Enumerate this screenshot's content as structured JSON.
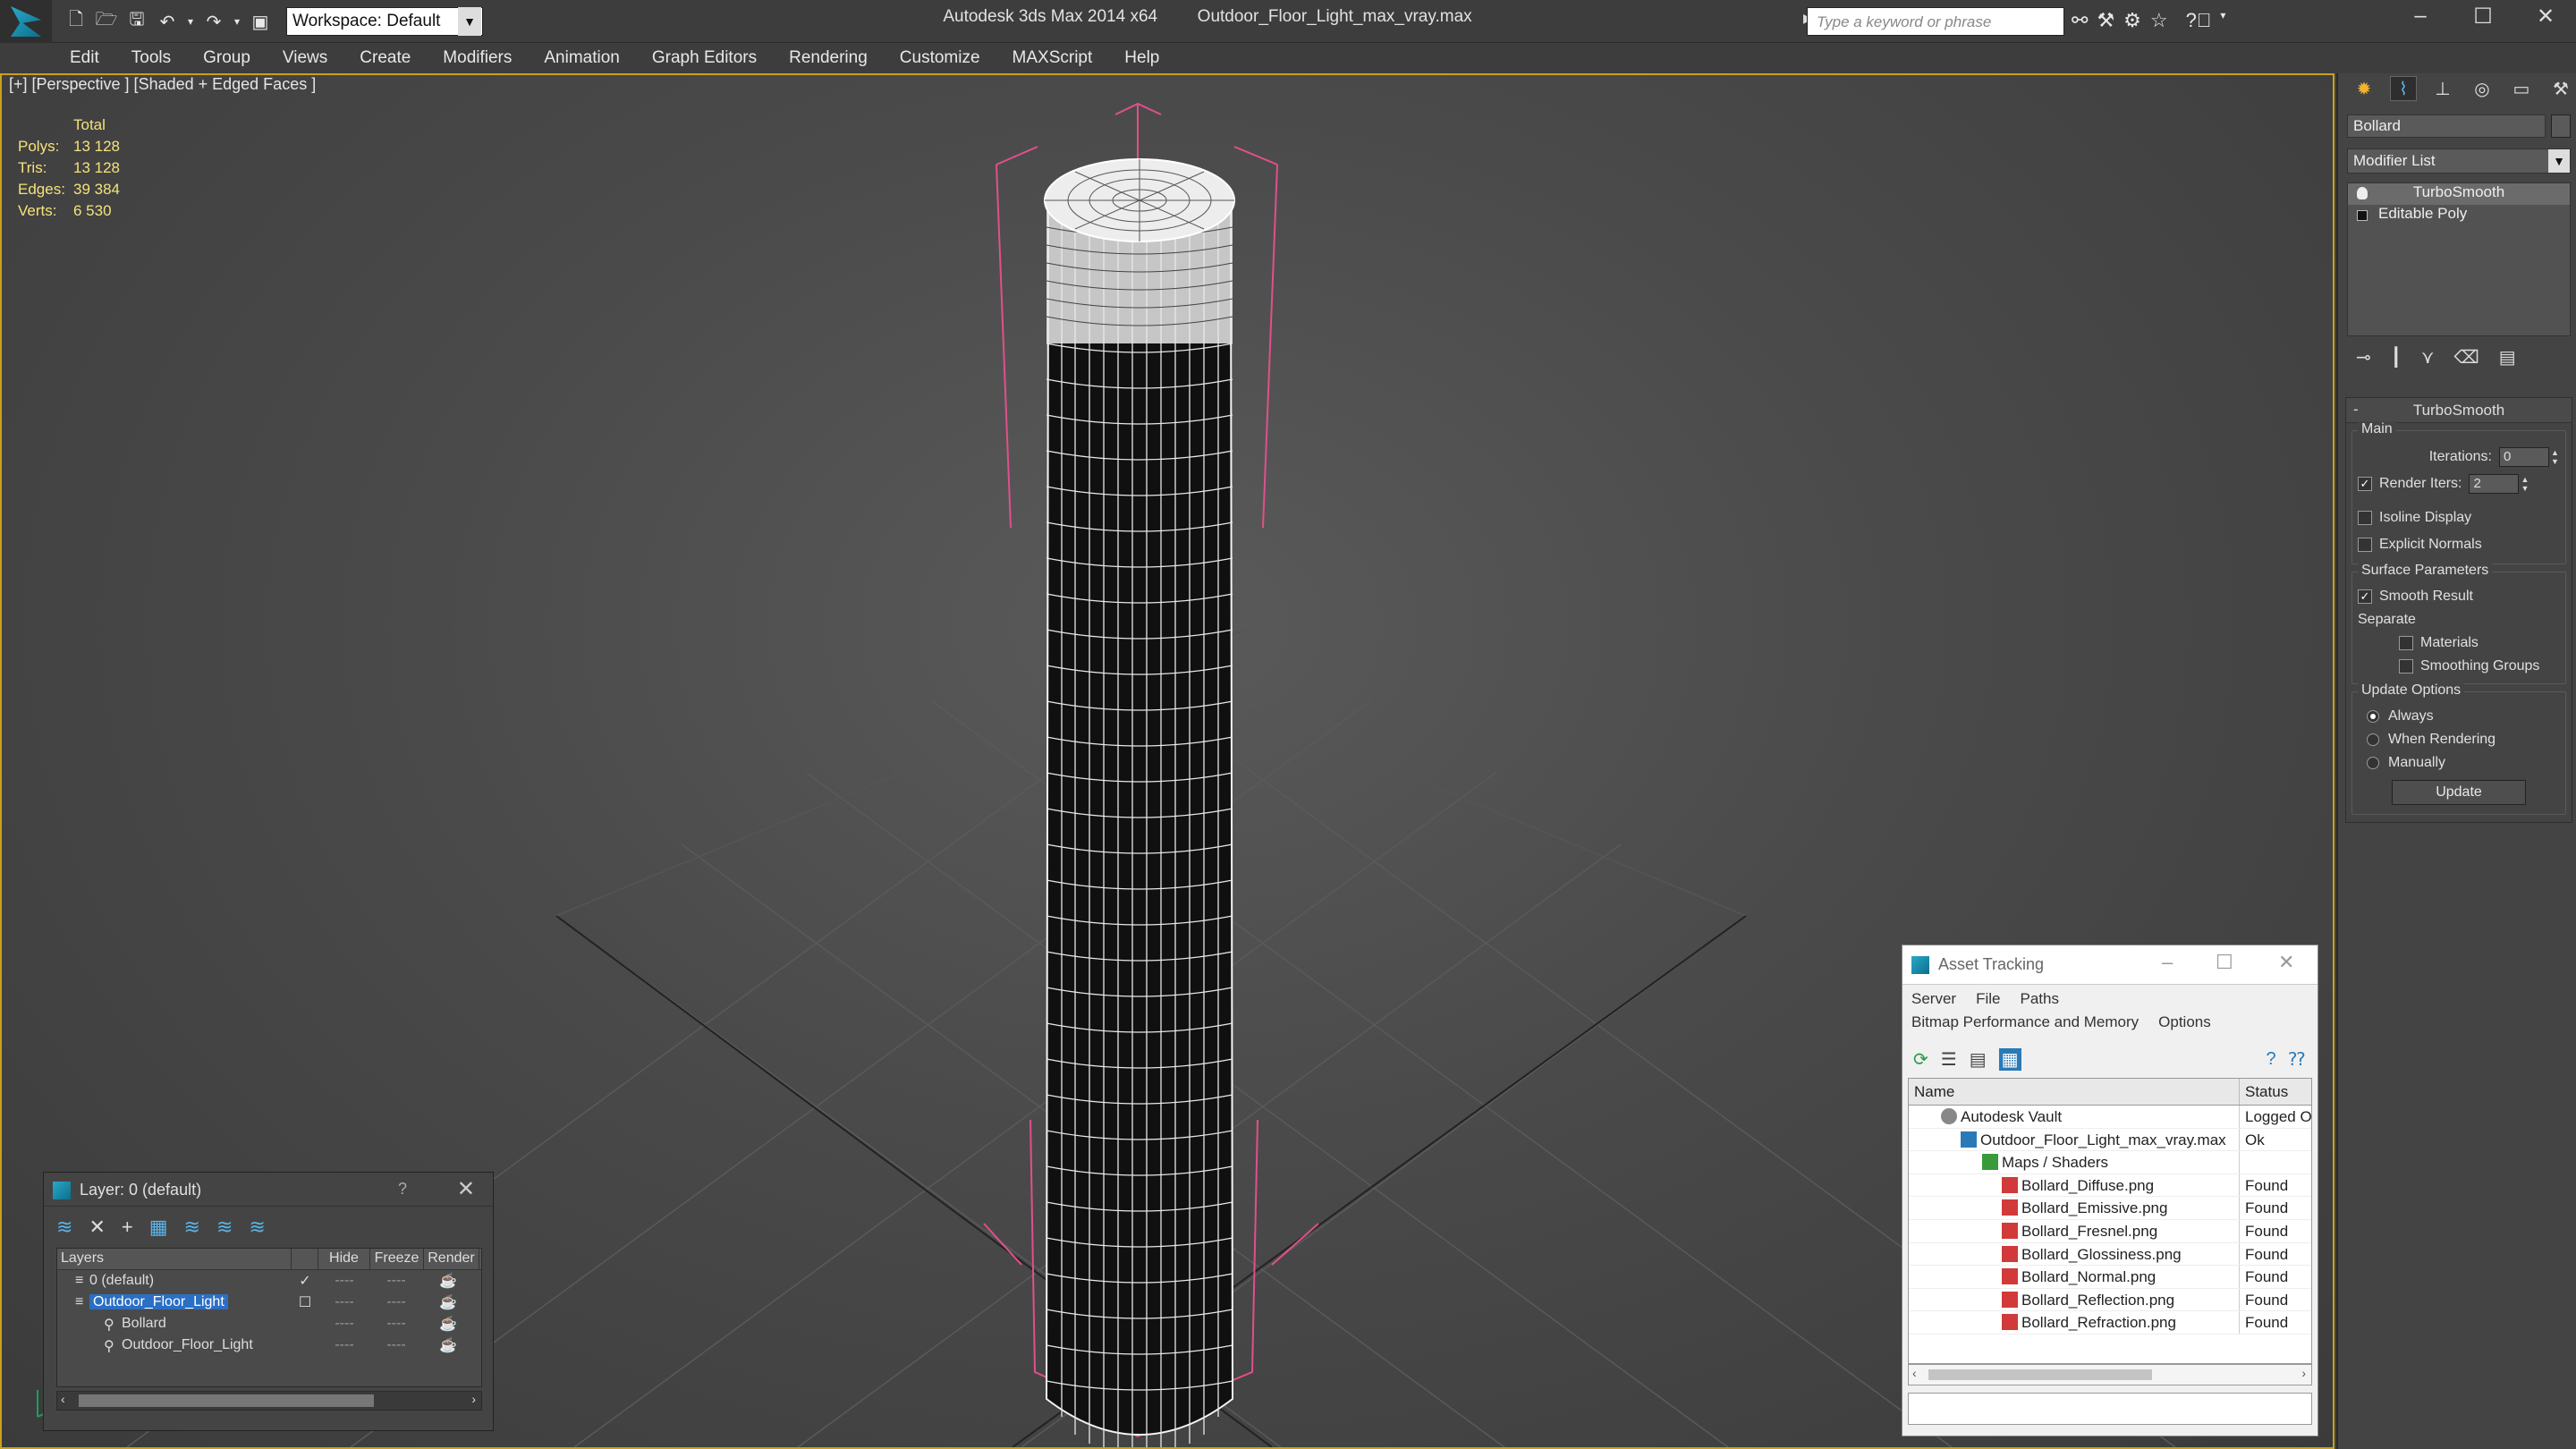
{
  "app": {
    "title": "Autodesk 3ds Max  2014 x64",
    "file": "Outdoor_Floor_Light_max_vray.max",
    "workspace": "Workspace: Default",
    "search_placeholder": "Type a keyword or phrase"
  },
  "menu": [
    "Edit",
    "Tools",
    "Group",
    "Views",
    "Create",
    "Modifiers",
    "Animation",
    "Graph Editors",
    "Rendering",
    "Customize",
    "MAXScript",
    "Help"
  ],
  "viewport": {
    "label": "[+] [Perspective ] [Shaded + Edged Faces ]",
    "stats": {
      "header": "Total",
      "rows": [
        {
          "label": "Polys:",
          "value": "13 128"
        },
        {
          "label": "Tris:",
          "value": "13 128"
        },
        {
          "label": "Edges:",
          "value": "39 384"
        },
        {
          "label": "Verts:",
          "value": "6 530"
        }
      ]
    }
  },
  "command_panel": {
    "object_name": "Bollard",
    "modifier_list": "Modifier List",
    "stack": [
      "TurboSmooth",
      "Editable Poly"
    ],
    "rollout_title": "TurboSmooth",
    "main_group": "Main",
    "iterations_label": "Iterations:",
    "iterations_value": "0",
    "render_iters_label": "Render Iters:",
    "render_iters_value": "2",
    "isoline": "Isoline Display",
    "explicit": "Explicit Normals",
    "surface_group": "Surface Parameters",
    "smooth_result": "Smooth Result",
    "separate": "Separate",
    "materials": "Materials",
    "smoothing_groups": "Smoothing Groups",
    "update_group": "Update Options",
    "always": "Always",
    "when_rendering": "When Rendering",
    "manually": "Manually",
    "update_button": "Update"
  },
  "layer_dialog": {
    "title": "Layer: 0 (default)",
    "help": "?",
    "headers": [
      "Layers",
      "Hide",
      "Freeze",
      "Render"
    ],
    "rows": [
      {
        "name": "0 (default)",
        "check": "✓"
      },
      {
        "name": "Outdoor_Floor_Light",
        "check": ""
      },
      {
        "name": "Bollard",
        "check": ""
      },
      {
        "name": "Outdoor_Floor_Light",
        "check": ""
      }
    ],
    "cell_dash": "----"
  },
  "asset_dialog": {
    "title": "Asset Tracking",
    "menu1": [
      "Server",
      "File",
      "Paths"
    ],
    "menu2": [
      "Bitmap Performance and Memory",
      "Options"
    ],
    "headers": [
      "Name",
      "Status"
    ],
    "rows": [
      {
        "name": "Autodesk Vault",
        "status": "Logged O"
      },
      {
        "name": "Outdoor_Floor_Light_max_vray.max",
        "status": "Ok"
      },
      {
        "name": "Maps / Shaders",
        "status": ""
      },
      {
        "name": "Bollard_Diffuse.png",
        "status": "Found"
      },
      {
        "name": "Bollard_Emissive.png",
        "status": "Found"
      },
      {
        "name": "Bollard_Fresnel.png",
        "status": "Found"
      },
      {
        "name": "Bollard_Glossiness.png",
        "status": "Found"
      },
      {
        "name": "Bollard_Normal.png",
        "status": "Found"
      },
      {
        "name": "Bollard_Reflection.png",
        "status": "Found"
      },
      {
        "name": "Bollard_Refraction.png",
        "status": "Found"
      }
    ]
  },
  "colors": {
    "accent_yellow": "#c8a11d",
    "stats_yellow": "#f5e27a",
    "selection_blue": "#2b6fc4",
    "bbox_pink": "#e0508a"
  }
}
